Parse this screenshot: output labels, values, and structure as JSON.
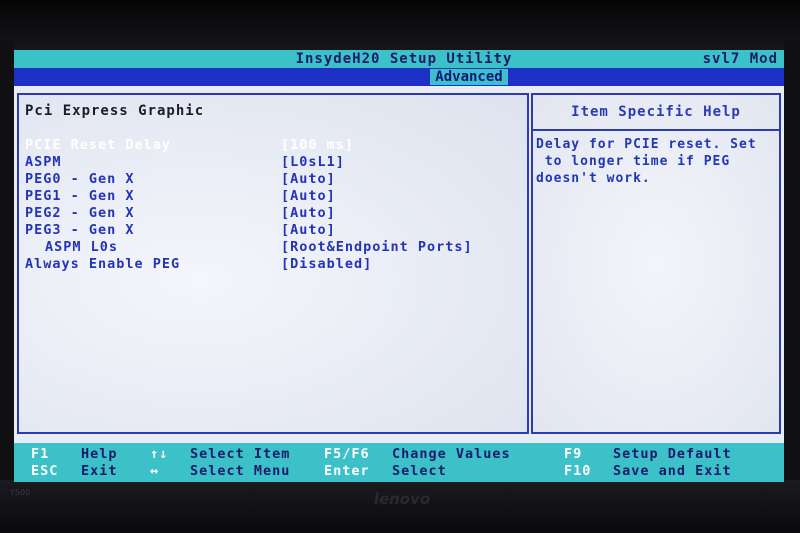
{
  "header": {
    "title": "InsydeH20 Setup Utility",
    "right_label": "svl7 Mod"
  },
  "menu": {
    "active_tab": "Advanced"
  },
  "main": {
    "section_title": "Pci Express Graphic",
    "options": [
      {
        "label": "PCIE Reset Delay",
        "value": "[100 ms]",
        "selected": true,
        "indent": false
      },
      {
        "label": "ASPM",
        "value": "[L0sL1]",
        "selected": false,
        "indent": false
      },
      {
        "label": "PEG0 - Gen X",
        "value": "[Auto]",
        "selected": false,
        "indent": false
      },
      {
        "label": "PEG1 - Gen X",
        "value": "[Auto]",
        "selected": false,
        "indent": false
      },
      {
        "label": "PEG2 - Gen X",
        "value": "[Auto]",
        "selected": false,
        "indent": false
      },
      {
        "label": "PEG3 - Gen X",
        "value": "[Auto]",
        "selected": false,
        "indent": false
      },
      {
        "label": "ASPM L0s",
        "value": "[Root&Endpoint Ports]",
        "selected": false,
        "indent": true
      },
      {
        "label": "Always Enable PEG",
        "value": "[Disabled]",
        "selected": false,
        "indent": false
      }
    ]
  },
  "help": {
    "title": "Item Specific Help",
    "lines": [
      "Delay for PCIE reset. Set",
      " to longer time if PEG",
      "doesn't work."
    ]
  },
  "footer": {
    "items": [
      {
        "key": "F1",
        "desc": "Help"
      },
      {
        "key": "ESC",
        "desc": "Exit"
      },
      {
        "key": "↑↓",
        "desc": "Select Item"
      },
      {
        "key": "↔",
        "desc": "Select Menu"
      },
      {
        "key": "F5/F6",
        "desc": "Change Values"
      },
      {
        "key": "Enter",
        "desc": "Select"
      },
      {
        "key": "F9",
        "desc": "Setup Default"
      },
      {
        "key": "F10",
        "desc": "Save and Exit"
      }
    ]
  },
  "bezel": {
    "brand": "lenovo",
    "model_mark": "Y500"
  },
  "colors": {
    "title_bar": "#3cc1c9",
    "menu_bar": "#1d2fc4",
    "option_text": "#2334b8",
    "selected_text": "#ffffff",
    "screen_background": "#e9ecf4"
  }
}
